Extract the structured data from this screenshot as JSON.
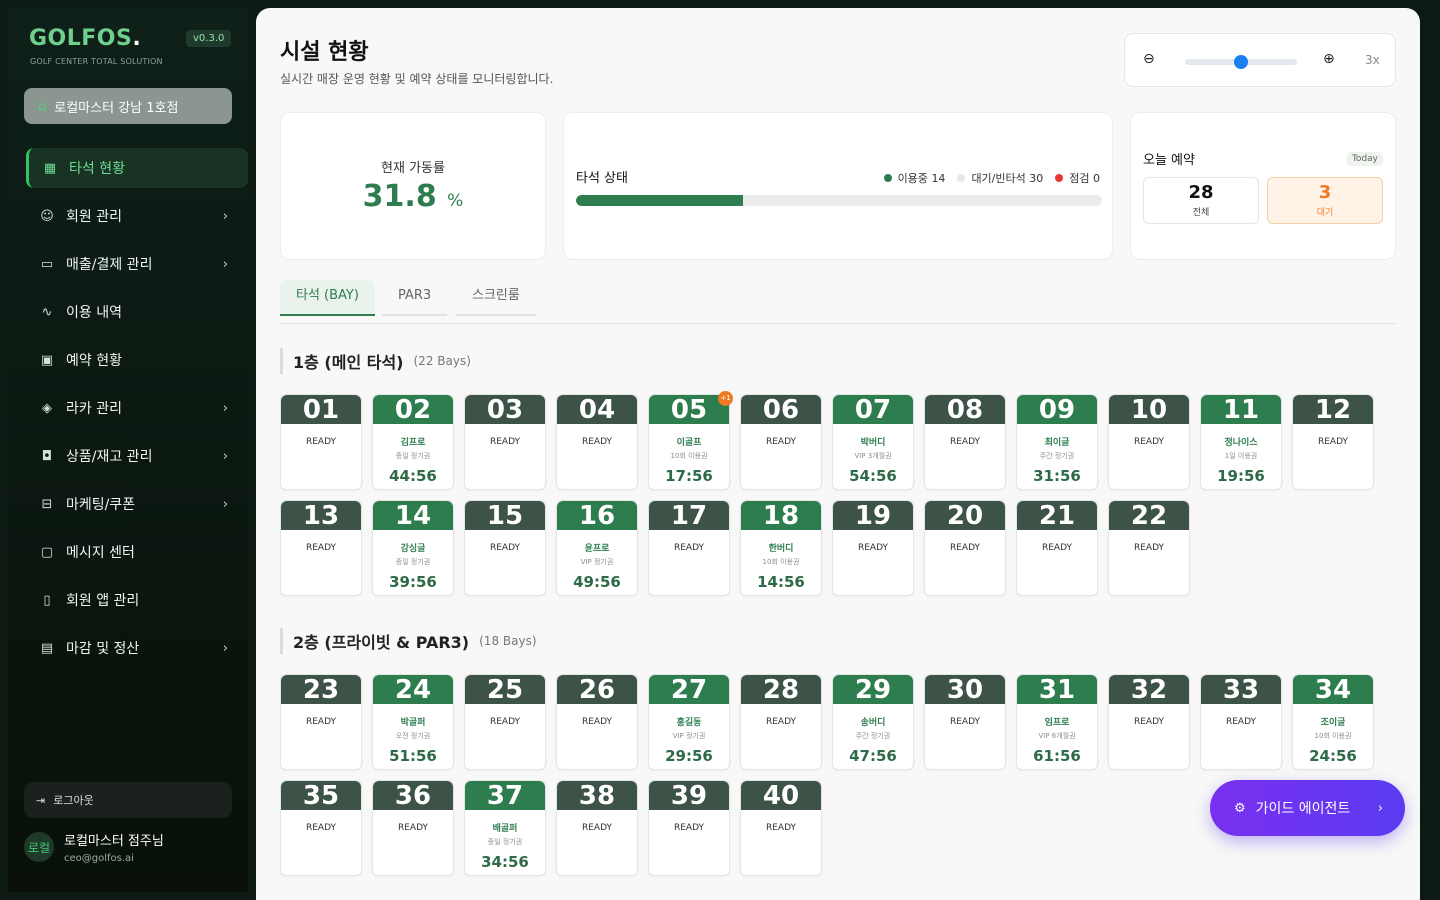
{
  "brand": {
    "name": "GOLFOS",
    "dot": ".",
    "tagline": "GOLF CENTER TOTAL SOLUTION",
    "version": "v0.3.0"
  },
  "store": {
    "name": "로컬마스터 강남 1호점"
  },
  "nav": [
    {
      "label": "타석 현황",
      "icon": "grid-icon",
      "active": true,
      "chevron": false
    },
    {
      "label": "회원 관리",
      "icon": "users-icon",
      "chevron": true
    },
    {
      "label": "매출/결제 관리",
      "icon": "card-icon",
      "chevron": true
    },
    {
      "label": "이용 내역",
      "icon": "activity-icon",
      "chevron": false
    },
    {
      "label": "예약 현황",
      "icon": "calendar-icon",
      "chevron": false
    },
    {
      "label": "라카 관리",
      "icon": "box-icon",
      "chevron": true
    },
    {
      "label": "상품/재고 관리",
      "icon": "bag-icon",
      "chevron": true
    },
    {
      "label": "마케팅/쿠폰",
      "icon": "ticket-icon",
      "chevron": true
    },
    {
      "label": "메시지 센터",
      "icon": "message-icon",
      "chevron": false
    },
    {
      "label": "회원 앱 관리",
      "icon": "phone-icon",
      "chevron": false
    },
    {
      "label": "마감 및 정산",
      "icon": "calculator-icon",
      "chevron": true
    }
  ],
  "logout": {
    "label": "로그아웃"
  },
  "user": {
    "avatar": "로컬",
    "name": "로컬마스터 점주님",
    "email": "ceo@golfos.ai"
  },
  "page": {
    "title": "시설 현황",
    "subtitle": "실시간 매장 운영 현황 및 예약 상태를 모니터링합니다."
  },
  "zoom": {
    "level": "3x",
    "slider": 0.5
  },
  "occupancy": {
    "label": "현재 가동률",
    "value": "31.8",
    "unit": "%"
  },
  "bay_status": {
    "title": "타석 상태",
    "in_use_label": "이용중",
    "in_use": "14",
    "idle_label": "대기/빈타석",
    "idle": "30",
    "maint_label": "점검",
    "maint": "0",
    "progress": 0.318,
    "colors": {
      "in_use": "#2e7d4f",
      "idle": "#e6e9e7",
      "maint": "#e53935"
    }
  },
  "reservations": {
    "title": "오늘 예약",
    "badge": "Today",
    "total": "28",
    "total_label": "전체",
    "waiting": "3",
    "waiting_label": "대기"
  },
  "tabs": [
    {
      "label": "타석 (BAY)",
      "active": true
    },
    {
      "label": "PAR3"
    },
    {
      "label": "스크린룸"
    }
  ],
  "ready_label": "READY",
  "floors": [
    {
      "title": "1층 (메인 타석)",
      "count": "(22 Bays)",
      "bays": [
        {
          "no": "01"
        },
        {
          "no": "02",
          "user": "김프로",
          "plan": "종일 정기권",
          "time": "44:56"
        },
        {
          "no": "03"
        },
        {
          "no": "04"
        },
        {
          "no": "05",
          "user": "이골프",
          "plan": "10회 이용권",
          "time": "17:56",
          "badge": "+1"
        },
        {
          "no": "06"
        },
        {
          "no": "07",
          "user": "박버디",
          "plan": "VIP 3개월권",
          "time": "54:56"
        },
        {
          "no": "08"
        },
        {
          "no": "09",
          "user": "최이글",
          "plan": "주간 정기권",
          "time": "31:56"
        },
        {
          "no": "10"
        },
        {
          "no": "11",
          "user": "정나이스",
          "plan": "1일 이용권",
          "time": "19:56"
        },
        {
          "no": "12"
        },
        {
          "no": "13"
        },
        {
          "no": "14",
          "user": "강싱글",
          "plan": "종일 정기권",
          "time": "39:56"
        },
        {
          "no": "15"
        },
        {
          "no": "16",
          "user": "윤프로",
          "plan": "VIP 정기권",
          "time": "49:56"
        },
        {
          "no": "17"
        },
        {
          "no": "18",
          "user": "한버디",
          "plan": "10회 이용권",
          "time": "14:56"
        },
        {
          "no": "19"
        },
        {
          "no": "20"
        },
        {
          "no": "21"
        },
        {
          "no": "22"
        }
      ]
    },
    {
      "title": "2층 (프라이빗 & PAR3)",
      "count": "(18 Bays)",
      "bays": [
        {
          "no": "23"
        },
        {
          "no": "24",
          "user": "박골퍼",
          "plan": "오전 정기권",
          "time": "51:56"
        },
        {
          "no": "25"
        },
        {
          "no": "26"
        },
        {
          "no": "27",
          "user": "홍길동",
          "plan": "VIP 정기권",
          "time": "29:56"
        },
        {
          "no": "28"
        },
        {
          "no": "29",
          "user": "송버디",
          "plan": "주간 정기권",
          "time": "47:56"
        },
        {
          "no": "30"
        },
        {
          "no": "31",
          "user": "임프로",
          "plan": "VIP 6개월권",
          "time": "61:56"
        },
        {
          "no": "32"
        },
        {
          "no": "33"
        },
        {
          "no": "34",
          "user": "조이글",
          "plan": "10회 이용권",
          "time": "24:56"
        },
        {
          "no": "35"
        },
        {
          "no": "36"
        },
        {
          "no": "37",
          "user": "배골퍼",
          "plan": "종일 정기권",
          "time": "34:56"
        },
        {
          "no": "38"
        },
        {
          "no": "39"
        },
        {
          "no": "40"
        }
      ]
    }
  ],
  "agent": {
    "label": "가이드 에이전트"
  }
}
